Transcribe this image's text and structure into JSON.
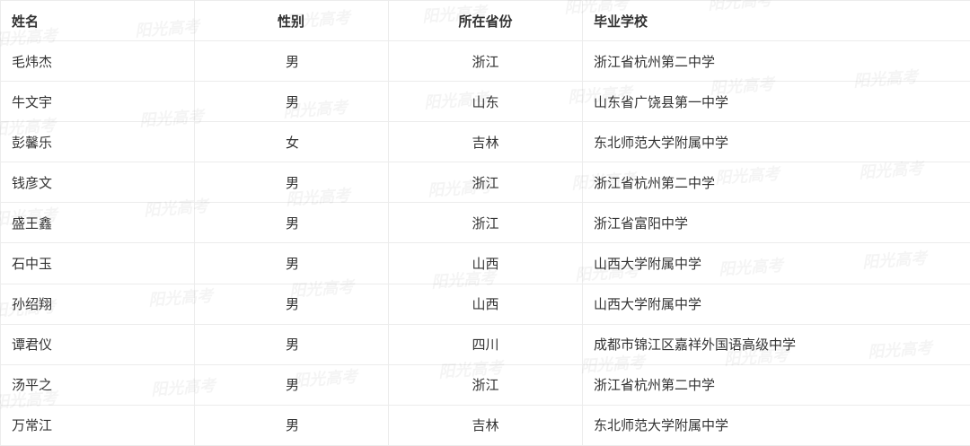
{
  "headers": {
    "name": "姓名",
    "gender": "性别",
    "province": "所在省份",
    "school": "毕业学校"
  },
  "rows": [
    {
      "name": "毛炜杰",
      "gender": "男",
      "province": "浙江",
      "school": "浙江省杭州第二中学"
    },
    {
      "name": "牛文宇",
      "gender": "男",
      "province": "山东",
      "school": "山东省广饶县第一中学"
    },
    {
      "name": "彭馨乐",
      "gender": "女",
      "province": "吉林",
      "school": "东北师范大学附属中学"
    },
    {
      "name": "钱彦文",
      "gender": "男",
      "province": "浙江",
      "school": "浙江省杭州第二中学"
    },
    {
      "name": "盛王鑫",
      "gender": "男",
      "province": "浙江",
      "school": "浙江省富阳中学"
    },
    {
      "name": "石中玉",
      "gender": "男",
      "province": "山西",
      "school": "山西大学附属中学"
    },
    {
      "name": "孙绍翔",
      "gender": "男",
      "province": "山西",
      "school": "山西大学附属中学"
    },
    {
      "name": "谭君仪",
      "gender": "男",
      "province": "四川",
      "school": "成都市锦江区嘉祥外国语高级中学"
    },
    {
      "name": "汤平之",
      "gender": "男",
      "province": "浙江",
      "school": "浙江省杭州第二中学"
    },
    {
      "name": "万常江",
      "gender": "男",
      "province": "吉林",
      "school": "东北师范大学附属中学"
    }
  ],
  "watermark": "阳光高考"
}
